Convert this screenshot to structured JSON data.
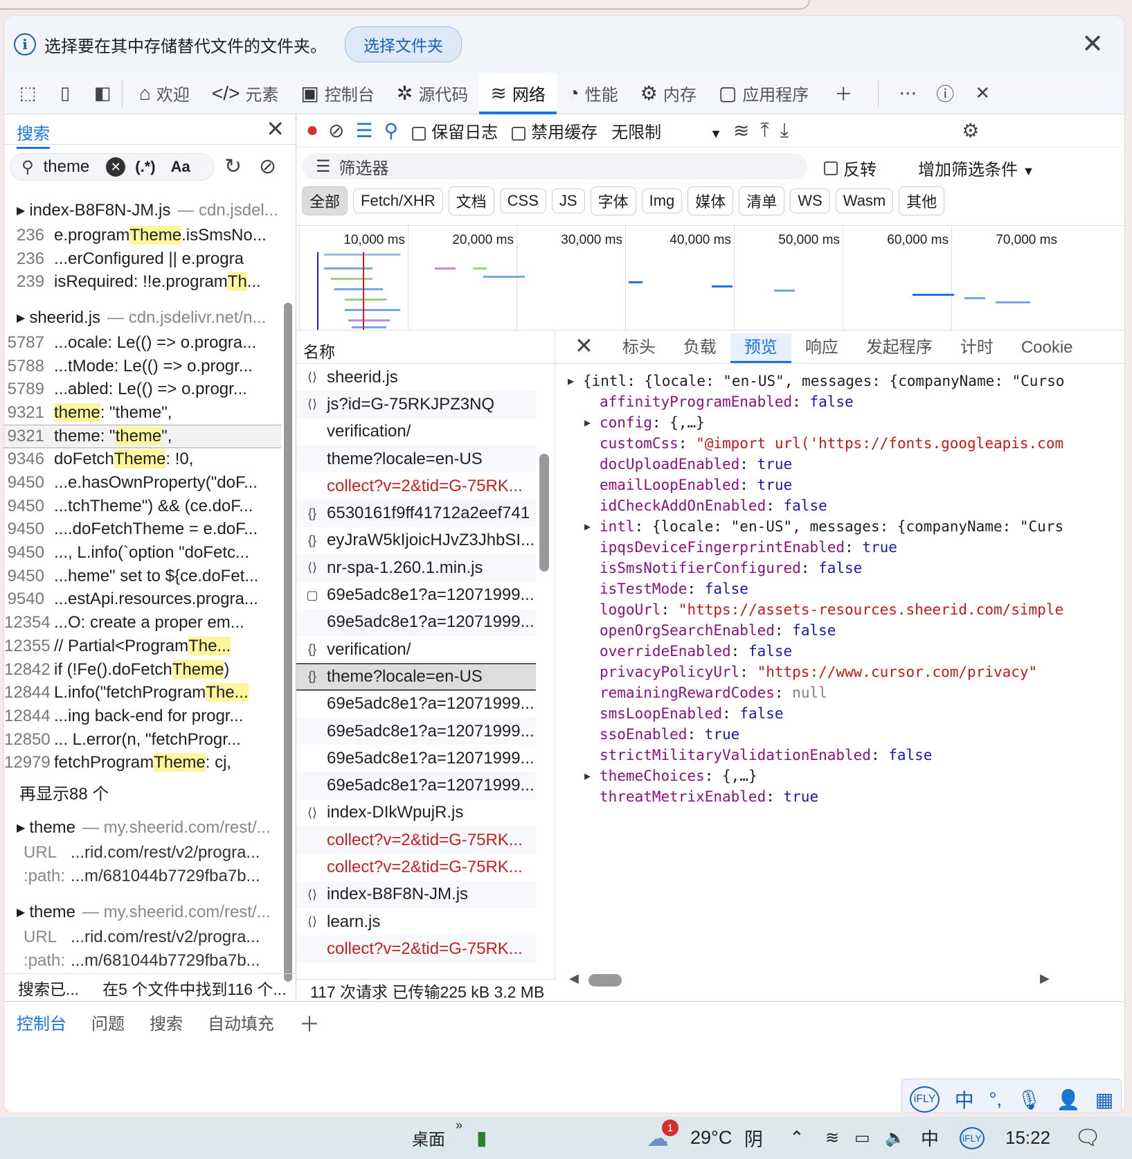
{
  "infobar": {
    "message": "选择要在其中存储替代文件的文件夹。",
    "button": "选择文件夹"
  },
  "tabs": [
    "欢迎",
    "元素",
    "控制台",
    "源代码",
    "网络",
    "性能",
    "内存",
    "应用程序"
  ],
  "search": {
    "title": "搜索",
    "query": "theme",
    "regex": "(.*)",
    "case": "Aa",
    "file1": {
      "name": "index-B8F8N-JM.js",
      "src": "cdn.jsdel..."
    },
    "f1lines": [
      [
        "236",
        "e.program",
        "Theme",
        ".isSmsNo..."
      ],
      [
        "236",
        "...erConfigured || e.progra",
        "",
        ""
      ],
      [
        "239",
        "isRequired: !!e.program",
        "Th",
        "..."
      ]
    ],
    "file2": {
      "name": "sheerid.js",
      "src": "cdn.jsdelivr.net/n..."
    },
    "f2lines": [
      [
        "5787",
        "...ocale: Le(() => o.progra...",
        "",
        ""
      ],
      [
        "5788",
        "...tMode: Le(() => o.progr...",
        "",
        ""
      ],
      [
        "5789",
        "...abled: Le(() => o.progr...",
        "",
        ""
      ],
      [
        "9321",
        "",
        "theme",
        ": \"theme\","
      ],
      [
        "9321",
        "theme: \"",
        "theme",
        "\","
      ],
      [
        "9346",
        "doFetch",
        "Theme",
        ": !0,"
      ],
      [
        "9450",
        "...e.hasOwnProperty(\"doF...",
        "",
        ""
      ],
      [
        "9450",
        "...tchTheme\") && (ce.doF...",
        "",
        ""
      ],
      [
        "9450",
        "....doFetchTheme = e.doF...",
        "",
        ""
      ],
      [
        "9450",
        "..., L.info(`option \"doFetc...",
        "",
        ""
      ],
      [
        "9450",
        "...heme\" set to ${ce.doFet...",
        "",
        ""
      ],
      [
        "9540",
        "...estApi.resources.progra...",
        "",
        ""
      ],
      [
        "12354",
        "...O: create a proper em...",
        "",
        ""
      ],
      [
        "12355",
        "// Partial<Program",
        "The...",
        ""
      ],
      [
        "12842",
        "if (!Fe().doFetch",
        "Theme",
        ")"
      ],
      [
        "12844",
        "L.info(\"fetchProgram",
        "The...",
        ""
      ],
      [
        "12844",
        "...ing back-end for progr...",
        "",
        ""
      ],
      [
        "12850",
        "... L.error(n, \"fetchProgr...",
        "",
        ""
      ],
      [
        "12979",
        "fetchProgram",
        "Theme",
        ": cj,"
      ]
    ],
    "more": "再显示88 个",
    "file3": {
      "name": "theme",
      "src": "my.sheerid.com/rest/...",
      "url": "...rid.com/rest/v2/progra...",
      "path": "...m/681044b7729fba7b..."
    },
    "file4": {
      "name": "theme",
      "src": "my.sheerid.com/rest/...",
      "url": "...rid.com/rest/v2/progra...",
      "path": "...m/681044b7729fba7b..."
    },
    "urlkey": "URL",
    "pathkey": ":path:",
    "status1": "搜索已...",
    "status2": "在5 个文件中找到116 个..."
  },
  "network": {
    "preserve": "保留日志",
    "disable_cache": "禁用缓存",
    "throttle": "无限制",
    "filter": "筛选器",
    "invert": "反转",
    "add_filter": "增加筛选条件",
    "types": [
      "全部",
      "Fetch/XHR",
      "文档",
      "CSS",
      "JS",
      "字体",
      "Img",
      "媒体",
      "清单",
      "WS",
      "Wasm",
      "其他"
    ],
    "ticks": [
      "10,000 ms",
      "20,000 ms",
      "30,000 ms",
      "40,000 ms",
      "50,000 ms",
      "60,000 ms",
      "70,000 ms"
    ],
    "name_col": "名称",
    "requests": [
      {
        "n": "sheerid.js",
        "t": "js"
      },
      {
        "n": "js?id=G-75RKJPZ3NQ",
        "t": "js"
      },
      {
        "n": "verification/",
        "t": ""
      },
      {
        "n": "theme?locale=en-US",
        "t": ""
      },
      {
        "n": "collect?v=2&tid=G-75RK...",
        "t": "",
        "red": true
      },
      {
        "n": "6530161f9ff41712a2eef741",
        "t": "json"
      },
      {
        "n": "eyJraW5kIjoicHJvZ3JhbSI...",
        "t": "json"
      },
      {
        "n": "nr-spa-1.260.1.min.js",
        "t": "js"
      },
      {
        "n": "69e5adc8e1?a=12071999...",
        "t": "doc"
      },
      {
        "n": "69e5adc8e1?a=12071999...",
        "t": ""
      },
      {
        "n": "verification/",
        "t": "json"
      },
      {
        "n": "theme?locale=en-US",
        "t": "json",
        "sel": true
      },
      {
        "n": "69e5adc8e1?a=12071999...",
        "t": ""
      },
      {
        "n": "69e5adc8e1?a=12071999...",
        "t": ""
      },
      {
        "n": "69e5adc8e1?a=12071999...",
        "t": ""
      },
      {
        "n": "69e5adc8e1?a=12071999...",
        "t": ""
      },
      {
        "n": "index-DIkWpujR.js",
        "t": "js"
      },
      {
        "n": "collect?v=2&tid=G-75RK...",
        "t": "",
        "red": true
      },
      {
        "n": "collect?v=2&tid=G-75RK...",
        "t": "",
        "red": true
      },
      {
        "n": "index-B8F8N-JM.js",
        "t": "js"
      },
      {
        "n": "learn.js",
        "t": "js"
      },
      {
        "n": "collect?v=2&tid=G-75RK...",
        "t": "",
        "red": true
      }
    ],
    "status": "117 次请求  已传输225 kB  3.2 MB"
  },
  "detail": {
    "tabs": [
      "标头",
      "负载",
      "预览",
      "响应",
      "发起程序",
      "计时",
      "Cookie"
    ],
    "json": [
      {
        "raw": "{intl: {locale: \"en-US\", messages: {companyName: \"Curso",
        "root": true
      },
      {
        "k": "affinityProgramEnabled",
        "v": "false",
        "c": "jb"
      },
      {
        "k": "config",
        "v": "{,…}",
        "c": "",
        "tri": true
      },
      {
        "k": "customCss",
        "v": "\"@import url('https://fonts.googleapis.com",
        "c": "js"
      },
      {
        "k": "docUploadEnabled",
        "v": "true",
        "c": "jb"
      },
      {
        "k": "emailLoopEnabled",
        "v": "true",
        "c": "jb"
      },
      {
        "k": "idCheckAddOnEnabled",
        "v": "false",
        "c": "jb"
      },
      {
        "k": "intl",
        "v": "{locale: \"en-US\", messages: {companyName: \"Curs",
        "c": "",
        "tri": true
      },
      {
        "k": "ipqsDeviceFingerprintEnabled",
        "v": "true",
        "c": "jb"
      },
      {
        "k": "isSmsNotifierConfigured",
        "v": "false",
        "c": "jb"
      },
      {
        "k": "isTestMode",
        "v": "false",
        "c": "jb"
      },
      {
        "k": "logoUrl",
        "v": "\"https://assets-resources.sheerid.com/simple",
        "c": "js"
      },
      {
        "k": "openOrgSearchEnabled",
        "v": "false",
        "c": "jb"
      },
      {
        "k": "overrideEnabled",
        "v": "false",
        "c": "jb"
      },
      {
        "k": "privacyPolicyUrl",
        "v": "\"https://www.cursor.com/privacy\"",
        "c": "js"
      },
      {
        "k": "remainingRewardCodes",
        "v": "null",
        "c": "jn"
      },
      {
        "k": "smsLoopEnabled",
        "v": "false",
        "c": "jb"
      },
      {
        "k": "ssoEnabled",
        "v": "true",
        "c": "jb"
      },
      {
        "k": "strictMilitaryValidationEnabled",
        "v": "false",
        "c": "jb"
      },
      {
        "k": "themeChoices",
        "v": "{,…}",
        "c": "",
        "tri": true
      },
      {
        "k": "threatMetrixEnabled",
        "v": "true",
        "c": "jb"
      }
    ]
  },
  "drawer": [
    "控制台",
    "问题",
    "搜索",
    "自动填充"
  ],
  "taskbar": {
    "desktop": "桌面",
    "badge": "1",
    "temp": "29°C",
    "weather": "阴",
    "ime": "中",
    "time": "15:22"
  }
}
